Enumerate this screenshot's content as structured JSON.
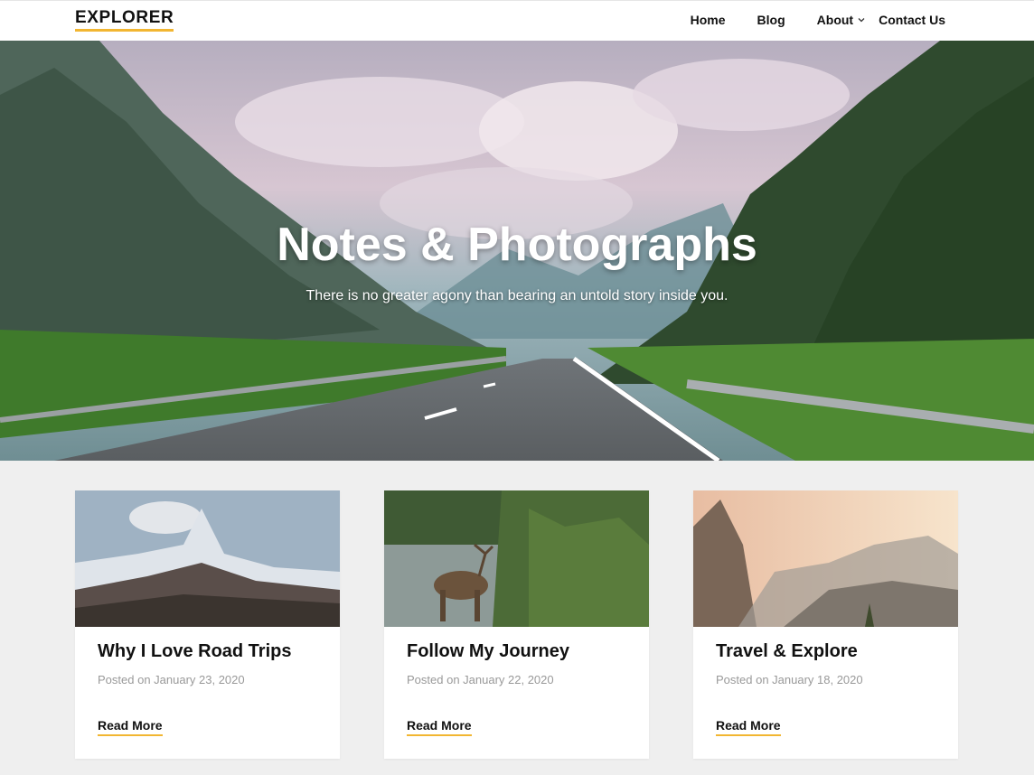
{
  "header": {
    "logo": "EXPLORER",
    "nav": [
      {
        "label": "Home"
      },
      {
        "label": "Blog"
      },
      {
        "label": "About"
      },
      {
        "label": "Contact Us"
      }
    ]
  },
  "hero": {
    "title": "Notes & Photographs",
    "subtitle": "There is no greater agony than bearing an untold story inside you."
  },
  "posts": [
    {
      "title": "Why I Love Road Trips",
      "date": "Posted on January 23, 2020",
      "more": "Read More"
    },
    {
      "title": "Follow My Journey",
      "date": "Posted on January 22, 2020",
      "more": "Read More"
    },
    {
      "title": "Travel & Explore",
      "date": "Posted on January 18, 2020",
      "more": "Read More"
    }
  ],
  "colors": {
    "accent": "#f2b632",
    "background": "#efefef"
  }
}
